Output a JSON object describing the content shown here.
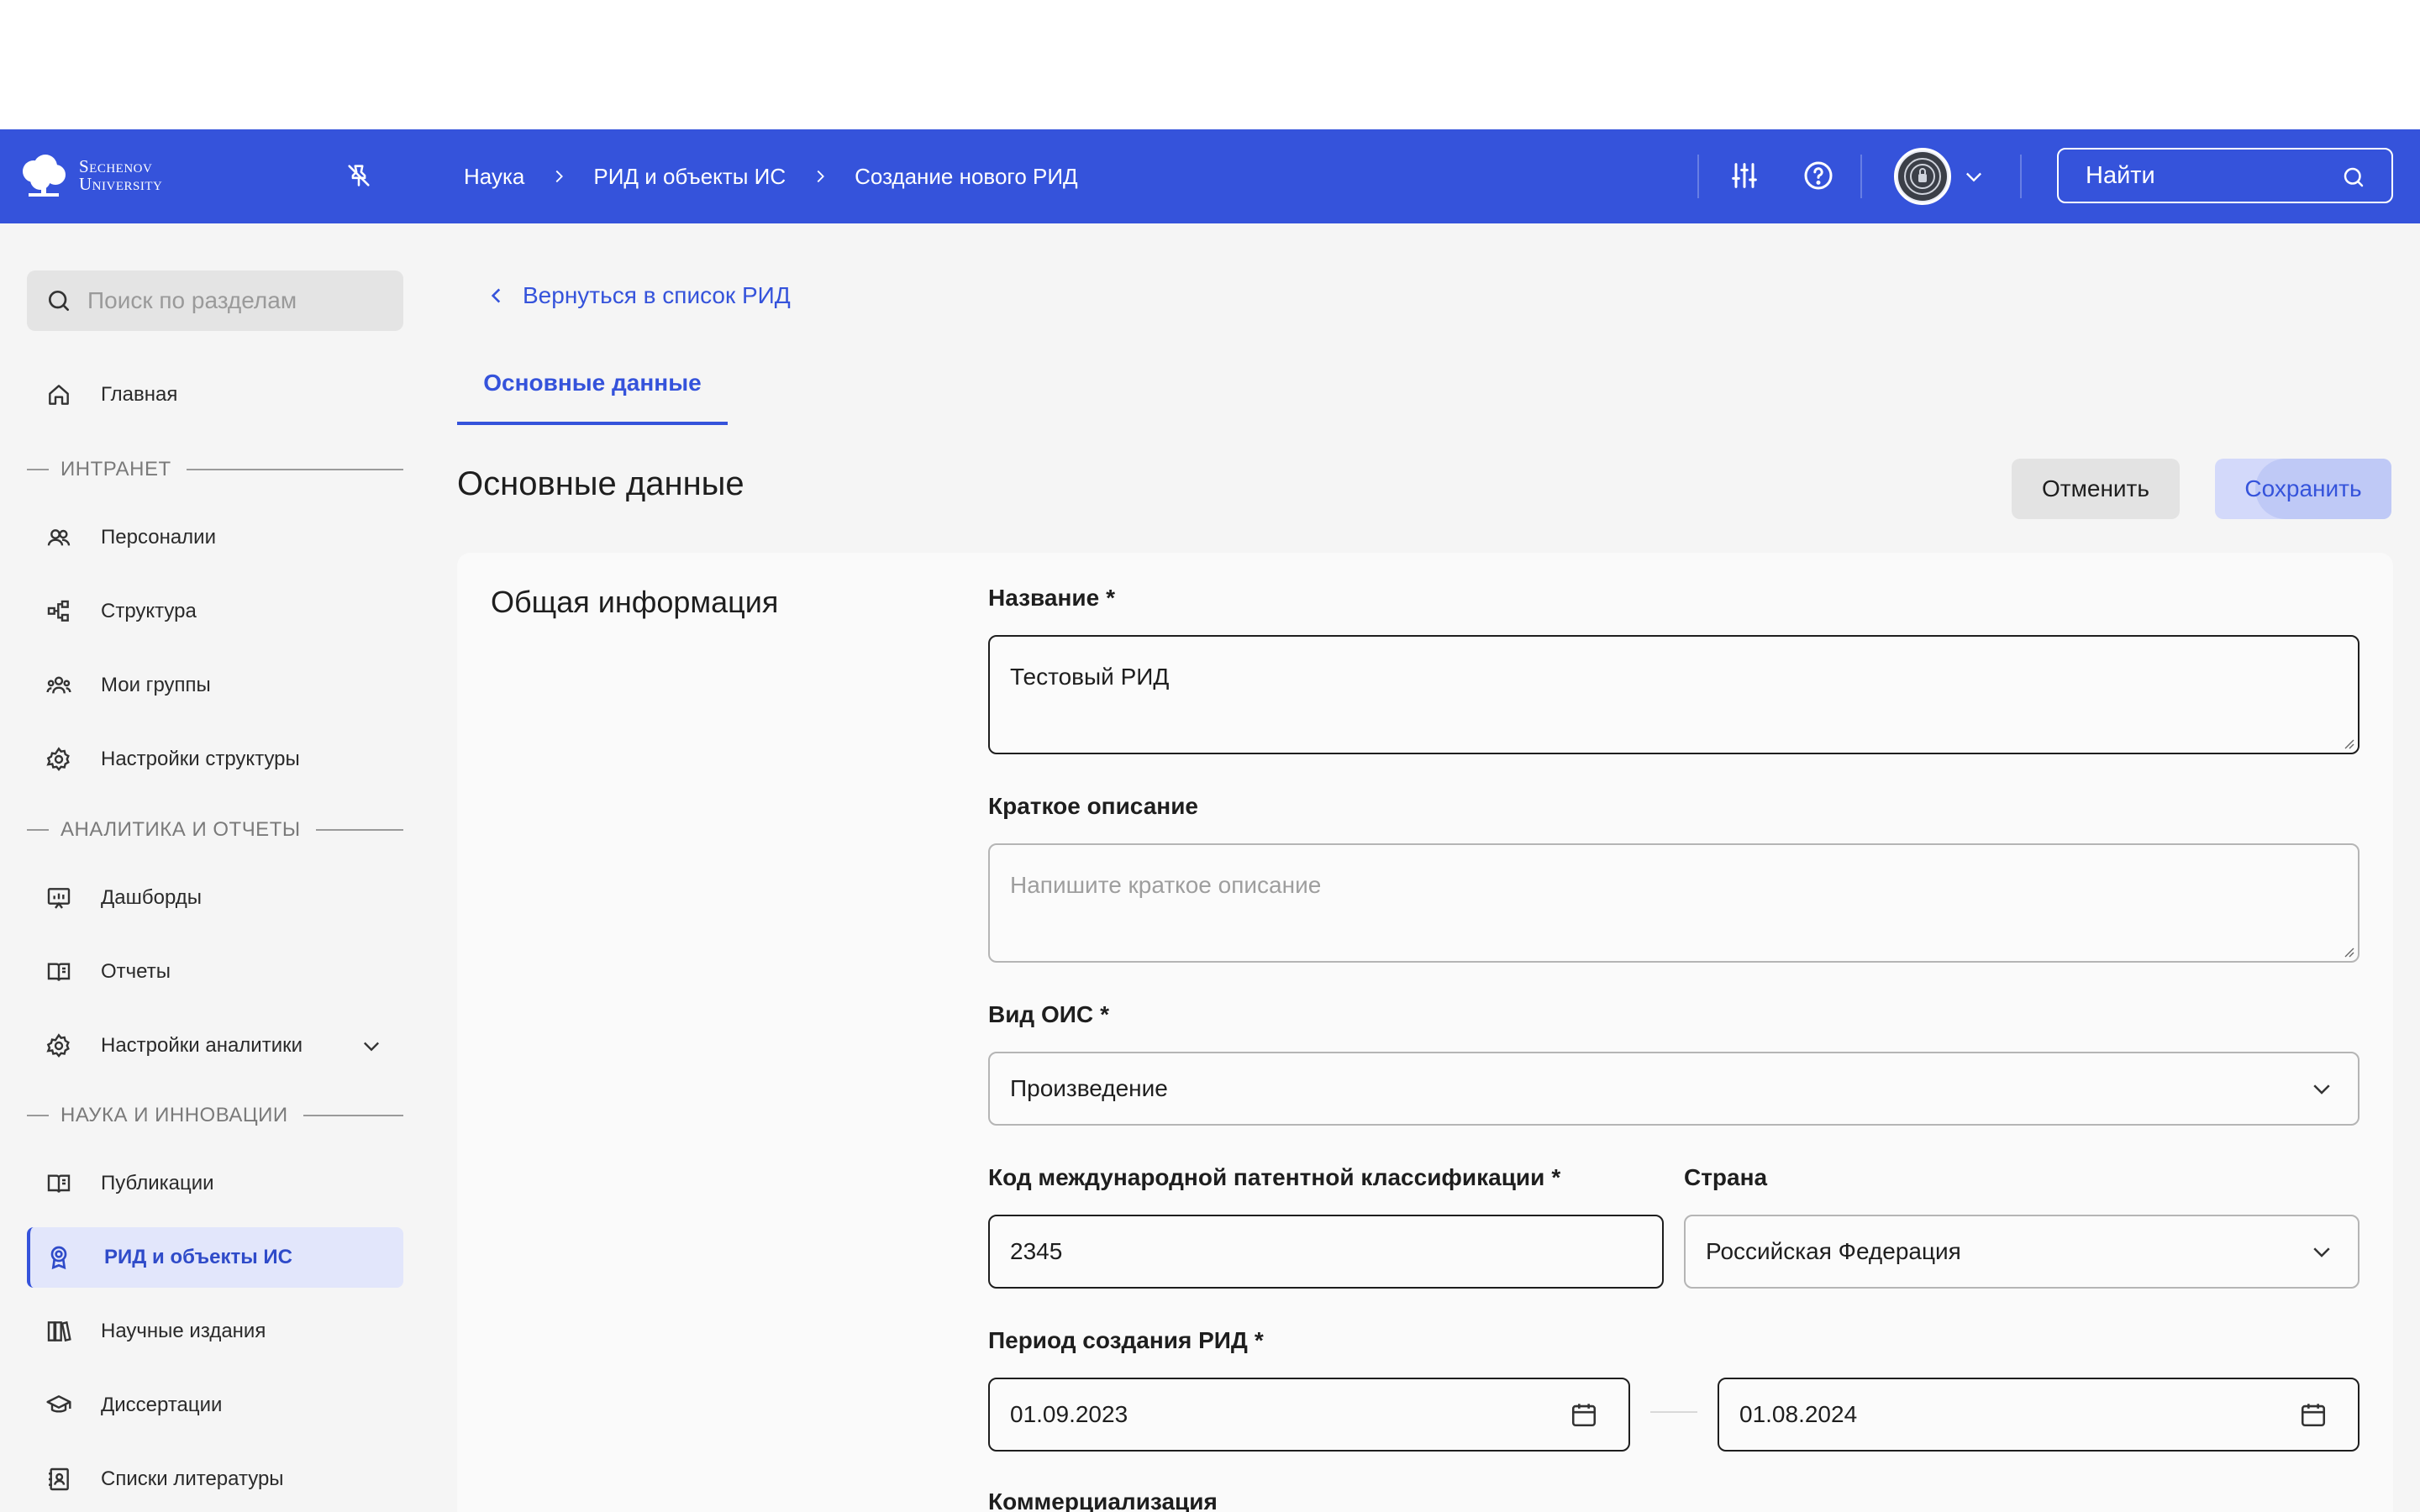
{
  "header": {
    "logo_line1": "Sechenov",
    "logo_line2": "University",
    "breadcrumbs": [
      "Наука",
      "РИД и объекты ИС",
      "Создание нового РИД"
    ],
    "search_placeholder": "Найти"
  },
  "sidebar": {
    "search_placeholder": "Поиск по разделам",
    "home": "Главная",
    "sections": [
      {
        "title": "ИНТРАНЕТ",
        "items": [
          "Персоналии",
          "Структура",
          "Мои группы",
          "Настройки структуры"
        ]
      },
      {
        "title": "АНАЛИТИКА И ОТЧЕТЫ",
        "items": [
          "Дашборды",
          "Отчеты",
          "Настройки аналитики"
        ]
      },
      {
        "title": "НАУКА И ИННОВАЦИИ",
        "items": [
          "Публикации",
          "РИД и объекты ИС",
          "Научные издания",
          "Диссертации",
          "Списки литературы"
        ]
      }
    ],
    "active_item": "РИД и объекты ИС"
  },
  "main": {
    "back_link": "Вернуться в список РИД",
    "tab": "Основные данные",
    "title": "Основные данные",
    "cancel_label": "Отменить",
    "save_label": "Сохранить",
    "card_title": "Общая информация",
    "fields": {
      "name": {
        "label": "Название",
        "required": "*",
        "value": "Тестовый РИД"
      },
      "description": {
        "label": "Краткое описание",
        "placeholder": "Напишите краткое описание"
      },
      "ois_type": {
        "label": "Вид ОИС",
        "required": "*",
        "value": "Произведение"
      },
      "ipc_code": {
        "label": "Код международной патентной классификации",
        "required": "*",
        "value": "2345"
      },
      "country": {
        "label": "Страна",
        "value": "Российская Федерация"
      },
      "period": {
        "label": "Период создания РИД",
        "required": "*",
        "start": "01.09.2023",
        "end": "01.08.2024"
      },
      "commercialization": {
        "label": "Коммерциализация"
      }
    }
  },
  "colors": {
    "brand": "#3553db",
    "active_bg": "#e2e6fb"
  }
}
